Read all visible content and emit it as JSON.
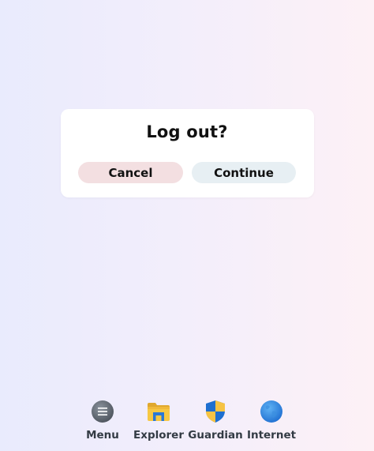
{
  "dialog": {
    "title": "Log out?",
    "cancel_label": "Cancel",
    "continue_label": "Continue"
  },
  "dock": {
    "items": [
      {
        "label": "Menu",
        "icon": "menu-icon"
      },
      {
        "label": "Explorer",
        "icon": "folder-icon"
      },
      {
        "label": "Guardian",
        "icon": "shield-icon"
      },
      {
        "label": "Internet",
        "icon": "globe-icon"
      }
    ]
  },
  "colors": {
    "cancel_bg": "#f3dfe1",
    "continue_bg": "#e7eff3",
    "dialog_bg": "#ffffff"
  }
}
